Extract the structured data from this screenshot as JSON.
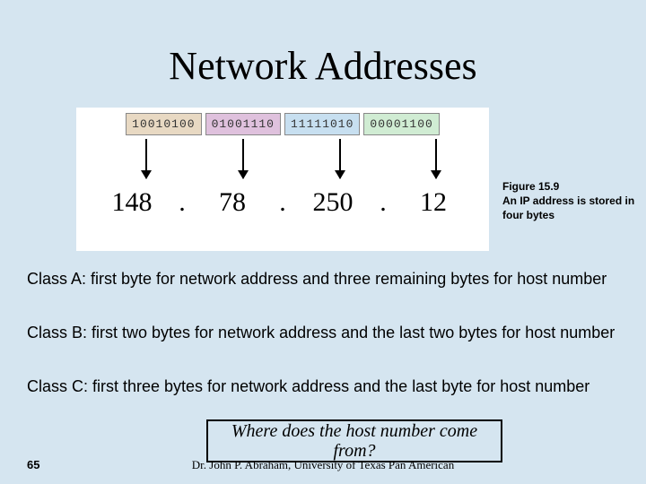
{
  "title": "Network Addresses",
  "figure": {
    "bytes_bin": [
      "10010100",
      "01001110",
      "11111010",
      "00001100"
    ],
    "bytes_dec": [
      "148",
      "78",
      "250",
      "12"
    ]
  },
  "caption": {
    "line1": "Figure 15.9",
    "line2": "An IP address is stored in four bytes"
  },
  "paragraphs": {
    "classA": "Class A: first byte for network address and three remaining bytes for host number",
    "classB": "Class B: first two bytes for network address and the last two bytes for host number",
    "classC": "Class C: first three bytes for network address and the last byte for host number"
  },
  "question": "Where does the host number come from?",
  "footer_author": "Dr. John P. Abraham, University of Texas Pan American",
  "page_number": "65"
}
